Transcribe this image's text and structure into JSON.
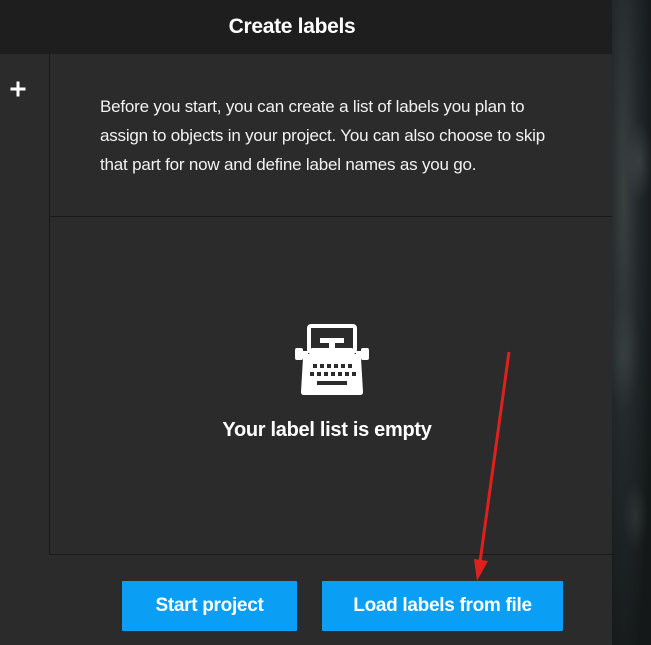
{
  "modal": {
    "title": "Create labels",
    "intro_text": "Before you start, you can create a list of labels you plan to assign to objects in your project. You can also choose to skip that part for now and define label names as you go.",
    "empty_state_text": "Your label list is empty",
    "empty_state_icon": "typewriter-icon",
    "add_icon": "plus-icon"
  },
  "footer": {
    "start_label": "Start project",
    "load_label": "Load labels from file"
  },
  "colors": {
    "primary_button": "#0a9ef5",
    "annotation_arrow": "#e0201c",
    "panel_background": "#2b2b2b",
    "header_background": "#1e1e1e"
  }
}
